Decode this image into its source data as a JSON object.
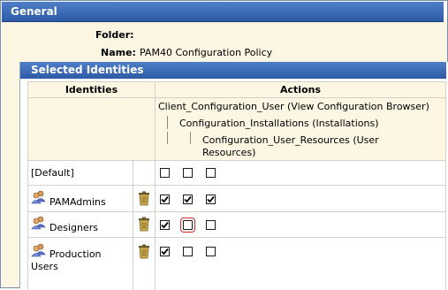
{
  "header": {
    "title": "General"
  },
  "policy": {
    "folder_label": "Folder:",
    "folder_value": "",
    "name_label": "Name:",
    "name_value": "PAM40 Configuration Policy"
  },
  "selected_identities": {
    "title": "Selected Identities",
    "columns": {
      "identities": "Identities",
      "actions": "Actions"
    },
    "actions_tree": {
      "level1": "Client_Configuration_User (View Configuration Browser)",
      "level2": "Configuration_Installations (Installations)",
      "level3_line1": "Configuration_User_Resources (User",
      "level3_line2": "Resources)"
    },
    "rows": [
      {
        "name": "[Default]",
        "line2": "",
        "has_icon": false,
        "has_delete": false,
        "checks": [
          false,
          false,
          false
        ]
      },
      {
        "name": "PAMAdmins",
        "line2": "",
        "has_icon": true,
        "has_delete": true,
        "checks": [
          true,
          true,
          true
        ]
      },
      {
        "name": "Designers",
        "line2": "",
        "has_icon": true,
        "has_delete": true,
        "checks": [
          true,
          false,
          false
        ]
      },
      {
        "name": "Production",
        "line2": "Users",
        "has_icon": true,
        "has_delete": true,
        "checks": [
          true,
          false,
          false
        ]
      }
    ]
  },
  "colors": {
    "header_blue": "#3a69b6",
    "cream": "#fcf6e3",
    "grid": "#d4d0c8",
    "focus": "#d42a2a"
  },
  "icons": [
    "users-icon",
    "trash-icon"
  ]
}
